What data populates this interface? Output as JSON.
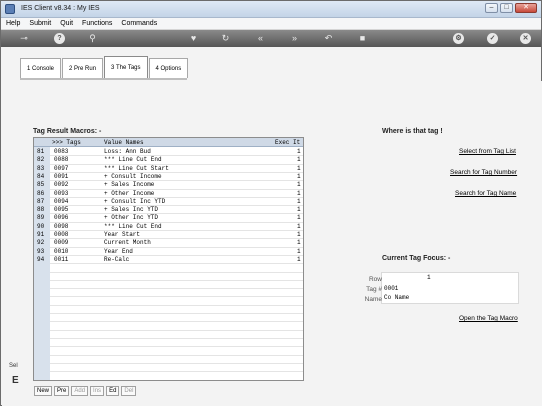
{
  "window": {
    "title": "IES Client v8.34 : My IES",
    "controls": [
      "–",
      "□",
      "✕"
    ]
  },
  "menu": [
    "Help",
    "Submit",
    "Quit",
    "Functions",
    "Commands"
  ],
  "tabs": [
    {
      "label": "1 Console",
      "active": false
    },
    {
      "label": "2 Pre Run",
      "active": false
    },
    {
      "label": "3 The Tags",
      "active": true
    },
    {
      "label": "4 Options",
      "active": false
    }
  ],
  "macros": {
    "title": "Tag Result Macros: -",
    "columns": {
      "tags": ">>> Tags",
      "names": "Value Names",
      "exec": "Exec It"
    },
    "rows": [
      {
        "n": "81",
        "tag": "0083",
        "name": "Loss: Ann Bud",
        "exec": "1"
      },
      {
        "n": "82",
        "tag": "0088",
        "name": "*** Line Cut End",
        "exec": "1"
      },
      {
        "n": "83",
        "tag": "0097",
        "name": "*** Line Cut Start",
        "exec": "1"
      },
      {
        "n": "84",
        "tag": "0091",
        "name": "+ Consult Income",
        "exec": "1"
      },
      {
        "n": "85",
        "tag": "0092",
        "name": "+ Sales Income",
        "exec": "1"
      },
      {
        "n": "86",
        "tag": "0093",
        "name": "+ Other Income",
        "exec": "1"
      },
      {
        "n": "87",
        "tag": "0094",
        "name": "+ Consult Inc YTD",
        "exec": "1"
      },
      {
        "n": "88",
        "tag": "0095",
        "name": "+ Sales Inc YTD",
        "exec": "1"
      },
      {
        "n": "89",
        "tag": "0096",
        "name": "+ Other Inc YTD",
        "exec": "1"
      },
      {
        "n": "90",
        "tag": "0098",
        "name": "*** Line Cut End",
        "exec": "1"
      },
      {
        "n": "91",
        "tag": "0008",
        "name": "Year Start",
        "exec": "1"
      },
      {
        "n": "92",
        "tag": "0009",
        "name": "Current Month",
        "exec": "1"
      },
      {
        "n": "93",
        "tag": "0010",
        "name": "Year End",
        "exec": "1"
      },
      {
        "n": "94",
        "tag": "0011",
        "name": "Re-Calc",
        "exec": "1"
      }
    ]
  },
  "bottom_buttons": [
    {
      "label": "New",
      "enabled": true
    },
    {
      "label": "Pre",
      "enabled": true
    },
    {
      "label": "Add",
      "enabled": false
    },
    {
      "label": "Ins",
      "enabled": false
    },
    {
      "label": "Ed",
      "enabled": true
    },
    {
      "label": "Del",
      "enabled": false
    }
  ],
  "side_stub": {
    "text": "Sel",
    "glyph": "E"
  },
  "where": {
    "title": "Where is that tag !",
    "links": [
      "Select from Tag List",
      "Search for Tag Number",
      "Search for Tag Name"
    ]
  },
  "focus": {
    "title": "Current Tag Focus: -",
    "row_label": "Row",
    "row_value": "1",
    "tag_label": "Tag #",
    "tag_value": "0001",
    "name_label": "Name",
    "name_value": "Co Name",
    "open_link": "Open the Tag Macro"
  }
}
